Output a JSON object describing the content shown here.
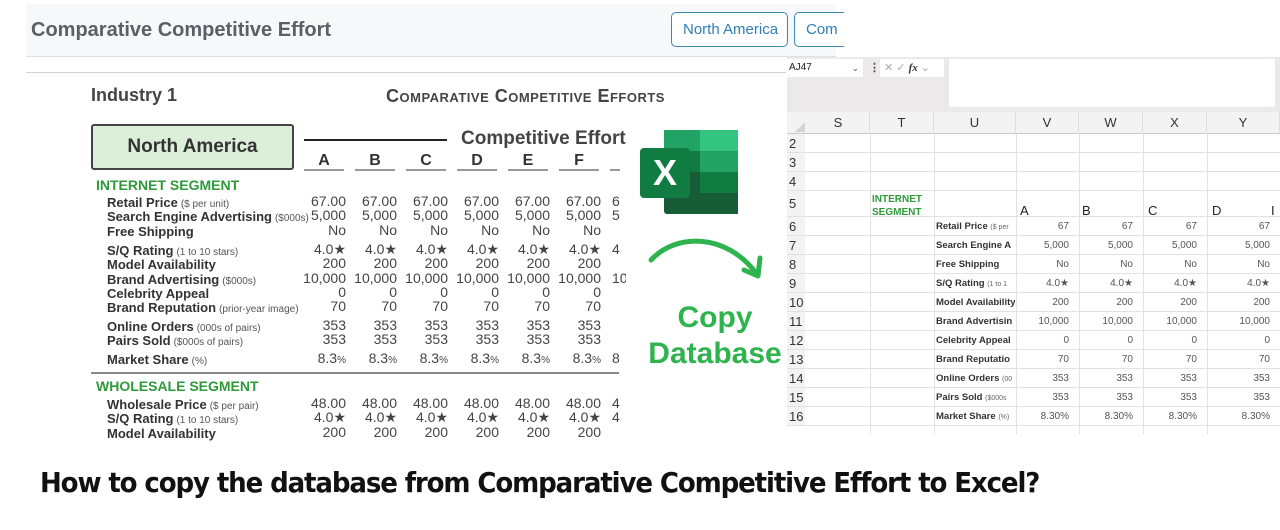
{
  "app": {
    "title": "Comparative Competitive Effort",
    "buttons": [
      "North America",
      "Com"
    ]
  },
  "report": {
    "industry": "Industry 1",
    "title": "Comparative Competitive Efforts",
    "region": "North America",
    "competitive_effort_label": "Competitive Effort",
    "columns": [
      "A",
      "B",
      "C",
      "D",
      "E",
      "F"
    ],
    "internet_segment": {
      "title": "INTERNET SEGMENT",
      "rows": [
        {
          "label": "Retail Price",
          "unit": "($ per unit)",
          "values": [
            "67.00",
            "67.00",
            "67.00",
            "67.00",
            "67.00",
            "67.00"
          ]
        },
        {
          "label": "Search Engine Advertising",
          "unit": "($000s)",
          "values": [
            "5,000",
            "5,000",
            "5,000",
            "5,000",
            "5,000",
            "5,000"
          ]
        },
        {
          "label": "Free Shipping",
          "unit": "",
          "values": [
            "No",
            "No",
            "No",
            "No",
            "No",
            "No"
          ]
        },
        {
          "label": "S/Q Rating",
          "unit": "(1 to 10 stars)",
          "values": [
            "4.0★",
            "4.0★",
            "4.0★",
            "4.0★",
            "4.0★",
            "4.0★"
          ]
        },
        {
          "label": "Model Availability",
          "unit": "",
          "values": [
            "200",
            "200",
            "200",
            "200",
            "200",
            "200"
          ]
        },
        {
          "label": "Brand Advertising",
          "unit": "($000s)",
          "values": [
            "10,000",
            "10,000",
            "10,000",
            "10,000",
            "10,000",
            "10,000"
          ]
        },
        {
          "label": "Celebrity Appeal",
          "unit": "",
          "values": [
            "0",
            "0",
            "0",
            "0",
            "0",
            "0"
          ]
        },
        {
          "label": "Brand Reputation",
          "unit": "(prior-year image)",
          "values": [
            "70",
            "70",
            "70",
            "70",
            "70",
            "70"
          ]
        },
        {
          "label": "Online Orders",
          "unit": "(000s of pairs)",
          "values": [
            "353",
            "353",
            "353",
            "353",
            "353",
            "353"
          ]
        },
        {
          "label": "Pairs Sold",
          "unit": "($000s of pairs)",
          "values": [
            "353",
            "353",
            "353",
            "353",
            "353",
            "353"
          ]
        },
        {
          "label": "Market Share",
          "unit": "(%)",
          "values": [
            "8.3",
            "8.3",
            "8.3",
            "8.3",
            "8.3",
            "8.3"
          ],
          "suffix": "%"
        }
      ]
    },
    "wholesale_segment": {
      "title": "WHOLESALE SEGMENT",
      "rows": [
        {
          "label": "Wholesale Price",
          "unit": "($ per pair)",
          "values": [
            "48.00",
            "48.00",
            "48.00",
            "48.00",
            "48.00",
            "48.00"
          ]
        },
        {
          "label": "S/Q Rating",
          "unit": "(1 to 10 stars)",
          "values": [
            "4.0★",
            "4.0★",
            "4.0★",
            "4.0★",
            "4.0★",
            "4.0★"
          ]
        },
        {
          "label": "Model Availability",
          "unit": "",
          "values": [
            "200",
            "200",
            "200",
            "200",
            "200",
            "200"
          ]
        }
      ]
    },
    "partial_column": {
      "internet": [
        "6",
        "5",
        "",
        "4",
        "",
        "10",
        "",
        "",
        "",
        "",
        "8"
      ],
      "wholesale": [
        "4",
        "4",
        ""
      ]
    }
  },
  "graphic": {
    "copy_text_line1": "Copy",
    "copy_text_line2": "Database",
    "accent": "#2fb34e"
  },
  "excel": {
    "name_box": "AJ47",
    "fx_label": "fx",
    "columns": [
      "S",
      "T",
      "U",
      "V",
      "W",
      "X",
      "Y"
    ],
    "row_numbers": [
      "2",
      "3",
      "4",
      "5",
      "6",
      "7",
      "8",
      "9",
      "10",
      "11",
      "12",
      "13",
      "14",
      "15",
      "16"
    ],
    "segment_label": [
      "INTERNET",
      "SEGMENT"
    ],
    "company_letters": [
      "A",
      "B",
      "C",
      "D",
      "I"
    ],
    "rows": [
      {
        "label": "Retail Price",
        "unit": "($ per",
        "values": [
          "67",
          "67",
          "67",
          "67"
        ]
      },
      {
        "label": "Search Engine A",
        "unit": "",
        "values": [
          "5,000",
          "5,000",
          "5,000",
          "5,000"
        ]
      },
      {
        "label": "Free Shipping",
        "unit": "",
        "values": [
          "No",
          "No",
          "No",
          "No"
        ]
      },
      {
        "label": "S/Q Rating",
        "unit": "(1 to 1",
        "values": [
          "4.0★",
          "4.0★",
          "4.0★",
          "4.0★"
        ]
      },
      {
        "label": "Model Availability",
        "unit": "",
        "values": [
          "200",
          "200",
          "200",
          "200"
        ]
      },
      {
        "label": "Brand Advertisin",
        "unit": "",
        "values": [
          "10,000",
          "10,000",
          "10,000",
          "10,000"
        ]
      },
      {
        "label": "Celebrity Appeal",
        "unit": "",
        "values": [
          "0",
          "0",
          "0",
          "0"
        ]
      },
      {
        "label": "Brand Reputatio",
        "unit": "",
        "values": [
          "70",
          "70",
          "70",
          "70"
        ]
      },
      {
        "label": "Online Orders",
        "unit": "(00",
        "values": [
          "353",
          "353",
          "353",
          "353"
        ]
      },
      {
        "label": "Pairs Sold",
        "unit": "($000s",
        "values": [
          "353",
          "353",
          "353",
          "353"
        ]
      },
      {
        "label": "Market Share",
        "unit": "(%)",
        "values": [
          "8.30%",
          "8.30%",
          "8.30%",
          "8.30%"
        ]
      }
    ]
  },
  "caption": "How to copy the database from Comparative Competitive Effort to Excel?"
}
